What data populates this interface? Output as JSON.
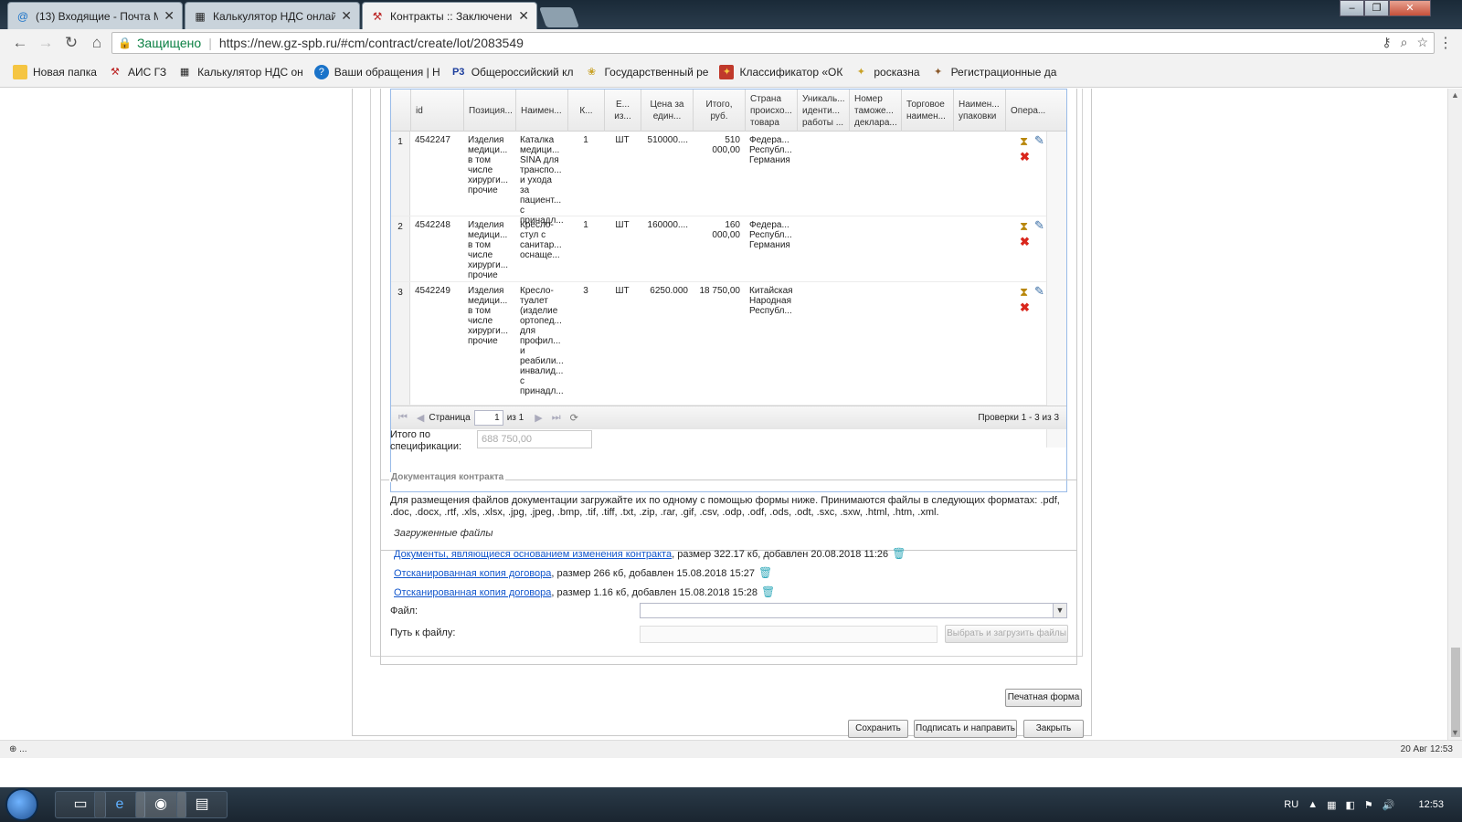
{
  "browser": {
    "tabs": [
      {
        "label": "(13) Входящие - Почта M",
        "icon": "mail-icon"
      },
      {
        "label": "Калькулятор НДС онлай",
        "icon": "calculator-icon"
      },
      {
        "label": "Контракты :: Заключени",
        "icon": "gz-icon"
      }
    ],
    "secure_label": "Защищено",
    "url": "https://new.gz-spb.ru/#cm/contract/create/lot/2083549",
    "bookmarks": [
      {
        "label": "Новая папка",
        "icon": "folder-icon"
      },
      {
        "label": "АИС ГЗ",
        "icon": "gz-icon"
      },
      {
        "label": "Калькулятор НДС он",
        "icon": "calculator-icon"
      },
      {
        "label": "Ваши обращения | Н",
        "icon": "globe-icon"
      },
      {
        "label": "Общероссийский кл",
        "icon": "classifier-icon"
      },
      {
        "label": "Государственный ре",
        "icon": "registry-icon"
      },
      {
        "label": "Классификатор «ОК",
        "icon": "emblem-icon"
      },
      {
        "label": "росказна",
        "icon": "emblem-icon"
      },
      {
        "label": "Регистрационные да",
        "icon": "emblem-icon"
      }
    ]
  },
  "grid": {
    "headers": [
      "id",
      "Позиция...",
      "Наимен...",
      "К...",
      "Е... из...",
      "Цена за един...",
      "Итого, руб.",
      "Страна происхо... товара",
      "Уникаль... иденти... работы ...",
      "Номер таможе... деклара...",
      "Торговое наимен...",
      "Наимен... упаковки",
      "Опера..."
    ],
    "rows": [
      {
        "num": "1",
        "id": "4542247",
        "position": "Изделия медици... в том числе хирурги... прочие",
        "name": "Каталка медици... SINA для транспо... и ухода за пациент... с принадл...",
        "qty": "1",
        "unit": "ШТ",
        "price": "510000....",
        "total": "510 000,00",
        "country": "Федера... Республ... Германия"
      },
      {
        "num": "2",
        "id": "4542248",
        "position": "Изделия медици... в том числе хирурги... прочие",
        "name": "Кресло-стул с санитар... оснаще...",
        "qty": "1",
        "unit": "ШТ",
        "price": "160000....",
        "total": "160 000,00",
        "country": "Федера... Республ... Германия"
      },
      {
        "num": "3",
        "id": "4542249",
        "position": "Изделия медици... в том числе хирурги... прочие",
        "name": "Кресло-туалет (изделие ортопед... для профил... и реабили... инвалид... с принадл...",
        "qty": "3",
        "unit": "ШТ",
        "price": "6250.000",
        "total": "18 750,00",
        "country": "Китайская Народная Республ..."
      }
    ],
    "pager": {
      "page_label": "Страница",
      "page_value": "1",
      "of_label": "из 1",
      "info": "Проверки 1 - 3 из 3"
    }
  },
  "spec_total": {
    "label": "Итого по спецификации:",
    "value": "688 750,00"
  },
  "docs": {
    "legend": "Документация контракта",
    "description": "Для размещения файлов документации загружайте их по одному с помощью формы ниже. Принимаются файлы в следующих форматах: .pdf, .doc, .docx, .rtf, .xls, .xlsx, .jpg, .jpeg, .bmp, .tif, .tiff, .txt, .zip, .rar, .gif, .csv, .odp, .odf, .ods, .odt, .sxc, .sxw, .html, .htm, .xml.",
    "uploaded_title": "Загруженные файлы",
    "files": [
      {
        "link": "Документы, являющиеся основанием изменения контракта",
        "info": ", размер 322.17 кб, добавлен 20.08.2018 11:26"
      },
      {
        "link": "Отсканированная копия договора",
        "info": ", размер 266 кб, добавлен 15.08.2018 15:27"
      },
      {
        "link": "Отсканированная копия договора",
        "info": ", размер 1.16 кб, добавлен 15.08.2018 15:28"
      }
    ],
    "file_label": "Файл:",
    "path_label": "Путь к файлу:",
    "upload_button": "Выбрать и загрузить файлы"
  },
  "buttons": {
    "print": "Печатная форма",
    "save": "Сохранить",
    "sign_send": "Подписать и направить",
    "close": "Закрыть"
  },
  "status": {
    "left": "⊕ ...",
    "right": "20 Авг 12:53"
  },
  "taskbar": {
    "lang": "RU",
    "time": "12:53"
  },
  "colors": {
    "link": "#1155cc",
    "grid_border": "#99bbe8",
    "secure": "#0b8043"
  }
}
